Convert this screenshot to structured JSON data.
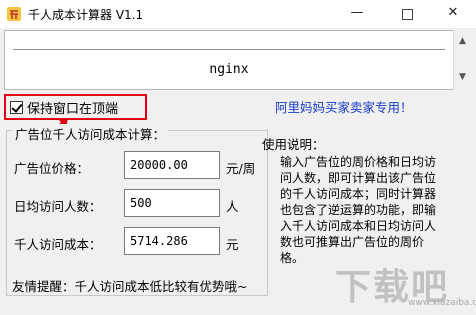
{
  "window": {
    "title": "千人成本计算器 V1.1",
    "minimize_glyph": "—",
    "close_glyph": "✕"
  },
  "banner": {
    "text": "nginx"
  },
  "keep_on_top": {
    "label": "保持窗口在顶端",
    "checked": true
  },
  "promo": {
    "text": "阿里妈妈买家卖家专用！"
  },
  "calculator": {
    "group_title": "广告位千人访问成本计算：",
    "rows": [
      {
        "label": "广告位价格：",
        "value": "20000.00",
        "unit": "元/周"
      },
      {
        "label": "日均访问人数：",
        "value": "500",
        "unit": "人"
      },
      {
        "label": "千人访问成本：",
        "value": "5714.286",
        "unit": "元"
      }
    ],
    "hint": "友情提醒：千人访问成本低比较有优势哦~"
  },
  "help": {
    "title": "使用说明：",
    "body": "输入广告位的周价格和日均访问人数，即可计算出该广告位的千人访问成本；同时计算器也包含了逆运算的功能，即输入千人访问成本和日均访问人数也可推算出广告位的周价格。"
  },
  "watermark": {
    "text": "下载吧",
    "url": "www.xiazaiba.com"
  },
  "colors": {
    "highlight": "#e60012",
    "promo": "#1a3cc8"
  }
}
